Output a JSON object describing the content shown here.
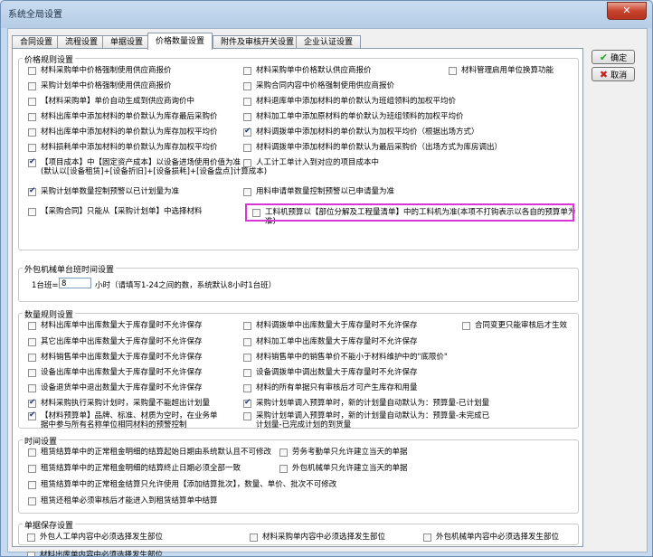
{
  "window": {
    "title": "系统全局设置",
    "close_glyph": "✕"
  },
  "tabs": [
    "合同设置",
    "流程设置",
    "单据设置",
    "价格数量设置",
    "附件及审核开关设置",
    "企业认证设置"
  ],
  "active_tab": 3,
  "buttons": {
    "ok": "确定",
    "cancel": "取消"
  },
  "price_rules": {
    "title": "价格规则设置",
    "items": [
      {
        "label": "材料采购单中价格强制使用供应商报价",
        "checked": false
      },
      {
        "label": "材料采购单中价格默认供应商报价",
        "checked": false
      },
      {
        "label": "材料管理启用单位换算功能",
        "checked": false
      },
      {
        "label": "采购计划单中价格强制使用供应商报价",
        "checked": false
      },
      {
        "label": "采购合同内容中价格强制使用供应商报价",
        "checked": false
      },
      {
        "label": "【材料采购单】单价自动生成到供应商询价中",
        "checked": false
      },
      {
        "label": "材料退库单中添加材料的单价默认为班组领料的加权平均价",
        "checked": false
      },
      {
        "label": "材料出库单中添加材料的单价默认为库存最后采购价",
        "checked": false
      },
      {
        "label": "材料加工单中添加原材料的单价默认为班组领料的加权平均价",
        "checked": false
      },
      {
        "label": "材料出库单中添加材料的单价默认为库存加权平均价",
        "checked": false
      },
      {
        "label": "材料调拨单中添加材料的单价默认为加权平均价（根据出场方式）",
        "checked": true
      },
      {
        "label": "材料损耗单中添加材料的单价默认为库存加权平均价",
        "checked": false
      },
      {
        "label": "材料调拨单中添加材料的单价默认为最后采购价（出场方式为库房调出）",
        "checked": false
      },
      {
        "label": "【项目成本】中【固定资产成本】以设备进场使用价值为准\n(默认以[设备租赁]+[设备折旧]+[设备损耗]+[设备盘点]计算成本)",
        "checked": true
      },
      {
        "label": "人工计工单计入到对应的项目成本中",
        "checked": false
      },
      {
        "label": "采购计划单数量控制预警以已计划量为准",
        "checked": true
      },
      {
        "label": "用料申请单数量控制预警以已申请量为准",
        "checked": false
      },
      {
        "label": "【采购合同】只能从【采购计划单】中选择材料",
        "checked": false
      },
      {
        "label": "工料机预算以【部位分解及工程量清单】中的工料机为准(本项不打钩表示以各自的预算单为准)",
        "checked": false
      }
    ]
  },
  "outsourcing": {
    "title": "外包机械单台班时间设置",
    "prefix": "1台班=",
    "value": "8",
    "suffix": "小时（请填写1-24之间的数，系统默认8小时1台班）"
  },
  "quantity_rules": {
    "title": "数量规则设置",
    "items": [
      {
        "label": "材料出库单中出库数量大于库存量时不允许保存",
        "checked": false
      },
      {
        "label": "材料调拨单中出库数量大于库存量时不允许保存",
        "checked": false
      },
      {
        "label": "合同变更只能审核后才生效",
        "checked": false
      },
      {
        "label": "其它出库单中出库数量大于库存量时不允许保存",
        "checked": false
      },
      {
        "label": "材料加工单中出库数量大于库存量时不允许保存",
        "checked": false
      },
      {
        "label": "材料销售单中出库数量大于库存量时不允许保存",
        "checked": false
      },
      {
        "label": "材料销售单中的销售单价不能小于材料维护中的\"底限价\"",
        "checked": false
      },
      {
        "label": "设备出库单中出库数量大于库存量时不允许保存",
        "checked": false
      },
      {
        "label": "设备调拨单中调出数量大于库存量时不允许保存",
        "checked": false
      },
      {
        "label": "设备退货单中退出数量大于库存量时不允许保存",
        "checked": false
      },
      {
        "label": "材料的所有单据只有审核后才可产生库存和用量",
        "checked": false
      },
      {
        "label": "材料采购执行采购计划时，采购量不能超出计划量",
        "checked": true
      },
      {
        "label": "采购计划单调入预算单时，新的计划量自动默认为：预算量-已计划量",
        "checked": true
      },
      {
        "label": "【材料预算单】品牌、标准、材质为空时，在业务单\n据中参与所有名称单位相同材料的预警控制",
        "checked": true
      },
      {
        "label": "采购计划单调入预算单时，新的计划量自动默认为：预算量-未完成已\n计划量-已完成计划的到货量",
        "checked": false
      }
    ]
  },
  "time_settings": {
    "title": "时间设置",
    "items": [
      {
        "label": "租赁结算单中的正常租金明细的结算起始日期由系统默认且不可修改",
        "checked": false
      },
      {
        "label": "劳务考勤单只允许建立当天的单据",
        "checked": false
      },
      {
        "label": "租赁结算单中的正常租金明细的结算终止日期必须全部一致",
        "checked": false
      },
      {
        "label": "外包机械单只允许建立当天的单据",
        "checked": false
      },
      {
        "label": "租赁结算单中的正常租金结算只允许使用【添加结算批次】，数量、单价、批次不可修改",
        "checked": false
      },
      {
        "label": "租赁还租单必须审核后才能进入到租赁结算单中结算",
        "checked": false
      }
    ]
  },
  "doc_save": {
    "title": "单据保存设置",
    "items": [
      {
        "label": "外包人工单内容中必须选择发生部位",
        "checked": false
      },
      {
        "label": "材料采购单内容中必须选择发生部位",
        "checked": false
      },
      {
        "label": "外包机械单内容中必须选择发生部位",
        "checked": false
      },
      {
        "label": "材料出库单内容中必须选择发生部位",
        "checked": false
      }
    ]
  }
}
